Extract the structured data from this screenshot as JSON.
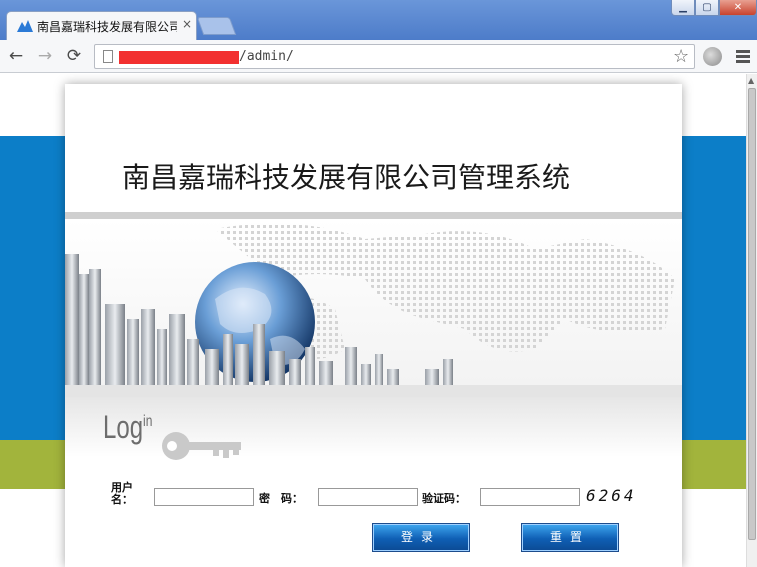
{
  "browser": {
    "tab_title": "南昌嘉瑞科技发展有限公司",
    "tab_close": "×",
    "url_suffix": "/admin/",
    "window": {
      "minimize": "▁",
      "maximize": "▢",
      "close": "✕"
    },
    "nav": {
      "back": "←",
      "forward": "→",
      "reload": "⟳"
    },
    "bookmark_star": "☆"
  },
  "page": {
    "system_title": "南昌嘉瑞科技发展有限公司管理系统",
    "login_heading": "Log",
    "login_heading_sup": "in",
    "form": {
      "username_label": "用户名：",
      "password_label": "密　码：",
      "captcha_label": "验证码：",
      "username_value": "",
      "password_value": "",
      "captcha_value": "",
      "captcha_code": "6264"
    },
    "buttons": {
      "login": "登录",
      "reset": "重置"
    }
  },
  "colors": {
    "band_blue": "#0c7ec8",
    "band_green": "#a2b43c",
    "button_blue": "#0f5fb4",
    "url_redaction": "#f23030"
  },
  "icons": [
    "page-favicon",
    "back-icon",
    "forward-icon",
    "reload-icon",
    "page-icon",
    "star-icon",
    "globe-icon",
    "menu-icon",
    "key-icon"
  ]
}
